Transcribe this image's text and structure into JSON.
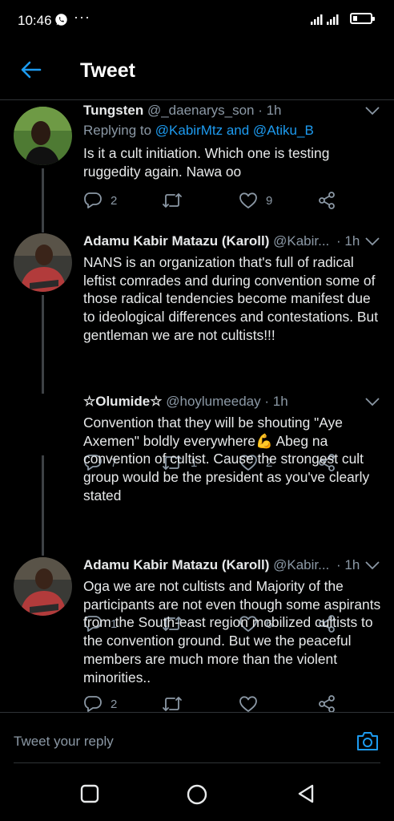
{
  "status_bar": {
    "time": "10:46",
    "extra": "···"
  },
  "header": {
    "title": "Tweet"
  },
  "tweets": [
    {
      "name": "Tungsten",
      "handle": "@_daenarys_son",
      "time": "· 1h",
      "replying_prefix": "Replying to",
      "replying_users": "@KabirMtz and @Atiku_B",
      "text": "Is it a cult initiation. Which one is testing ruggedity again. Nawa oo",
      "replies": "2",
      "retweets": "",
      "likes": "9"
    },
    {
      "name": "Adamu Kabir Matazu (Karoll)",
      "handle": "@Kabir...",
      "time": "· 1h",
      "text": "NANS is an organization that's full of radical leftist comrades and during convention some of those radical tendencies become manifest due to ideological differences and contestations. But gentleman we are not cultists!!!",
      "replies": "7",
      "retweets": "1",
      "likes": "2"
    },
    {
      "name": "☆Olumide☆",
      "handle": "@hoylumeeday",
      "time": "· 1h",
      "text": "Convention that they will be shouting \"Aye Axemen\" boldly everywhere💪 Abeg na convention of cultist. Cause the strongest cult group would be the president as you've clearly stated",
      "replies": "1",
      "retweets": "",
      "likes": "6"
    },
    {
      "name": "Adamu Kabir Matazu (Karoll)",
      "handle": "@Kabir...",
      "time": "· 1h",
      "text": "Oga we are not cultists and Majority of the participants are not even though some aspirants from the South-east region mobilized cultists to the convention ground. But we the peaceful members are much more than the violent minorities..",
      "replies": "2",
      "retweets": "",
      "likes": ""
    }
  ],
  "reply_bar": {
    "placeholder": "Tweet your reply"
  },
  "colors": {
    "accent": "#1d9bf0",
    "background": "#000000",
    "secondary_text": "#8b98a5"
  },
  "icons": [
    "back-arrow-icon",
    "chevron-down-icon",
    "reply-icon",
    "retweet-icon",
    "like-icon",
    "share-icon",
    "camera-icon",
    "recents-icon",
    "home-icon",
    "back-icon"
  ]
}
